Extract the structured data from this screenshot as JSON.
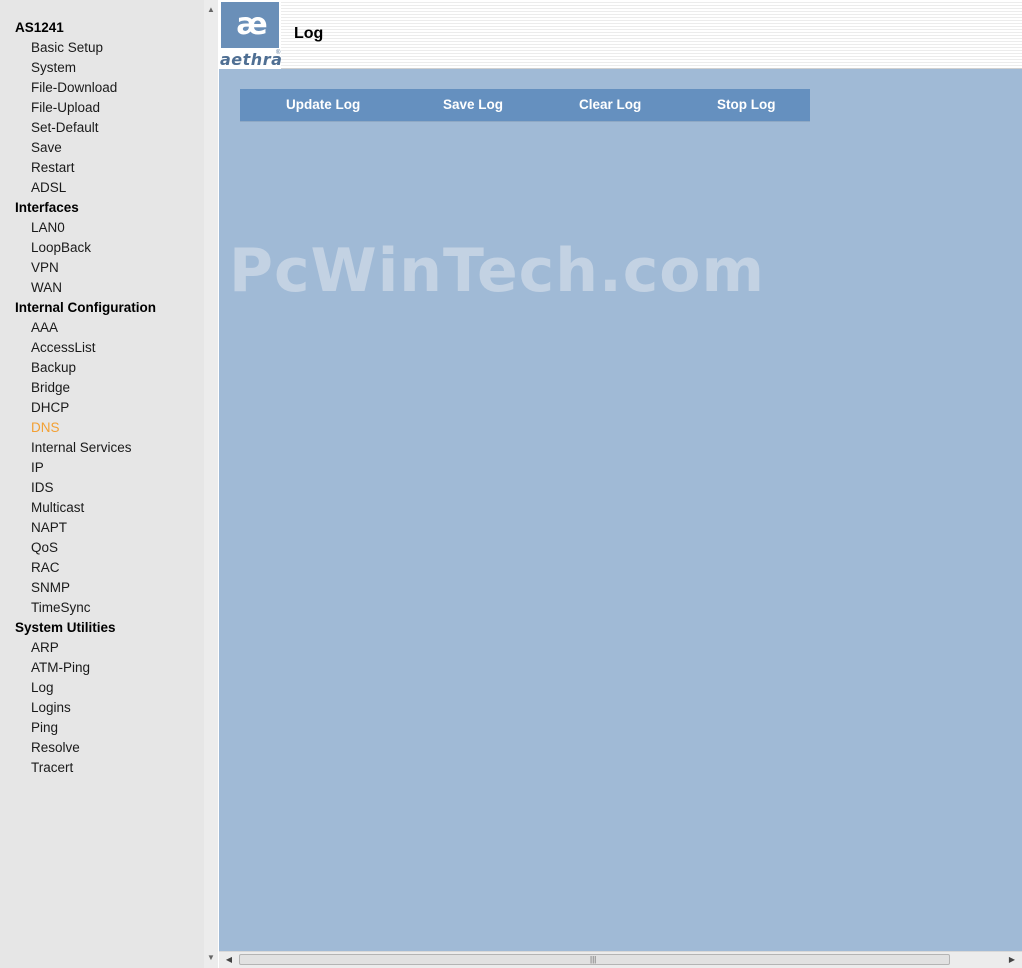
{
  "sidebar": {
    "sections": [
      {
        "title": "AS1241",
        "items": [
          "Basic Setup",
          "System",
          "File-Download",
          "File-Upload",
          "Set-Default",
          "Save",
          "Restart",
          "ADSL"
        ]
      },
      {
        "title": "Interfaces",
        "items": [
          "LAN0",
          "LoopBack",
          "VPN",
          "WAN"
        ]
      },
      {
        "title": "Internal Configuration",
        "items": [
          "AAA",
          "AccessList",
          "Backup",
          "Bridge",
          "DHCP",
          "DNS",
          "Internal Services",
          "IP",
          "IDS",
          "Multicast",
          "NAPT",
          "QoS",
          "RAC",
          "SNMP",
          "TimeSync"
        ]
      },
      {
        "title": "System Utilities",
        "items": [
          "ARP",
          "ATM-Ping",
          "Log",
          "Logins",
          "Ping",
          "Resolve",
          "Tracert"
        ]
      }
    ],
    "active_item": "DNS",
    "active_color": "#f3a033"
  },
  "header": {
    "logo_mark": "æ",
    "logo_word": "aethra",
    "logo_reg": "®",
    "title": "Log"
  },
  "toolbar": {
    "update_label": "Update Log",
    "save_label": "Save Log",
    "clear_label": "Clear Log",
    "stop_label": "Stop Log"
  },
  "watermark": "PcWinTech.com",
  "colors": {
    "content_bg": "#a0bad6",
    "toolbar_bg": "#6590bf",
    "logo_bg": "#6a8fb8"
  },
  "icons": {
    "scroll_up": "triangle-up-icon",
    "scroll_down": "triangle-down-icon",
    "scroll_left": "triangle-left-icon",
    "scroll_right": "triangle-right-icon",
    "grip": "grip-icon"
  }
}
